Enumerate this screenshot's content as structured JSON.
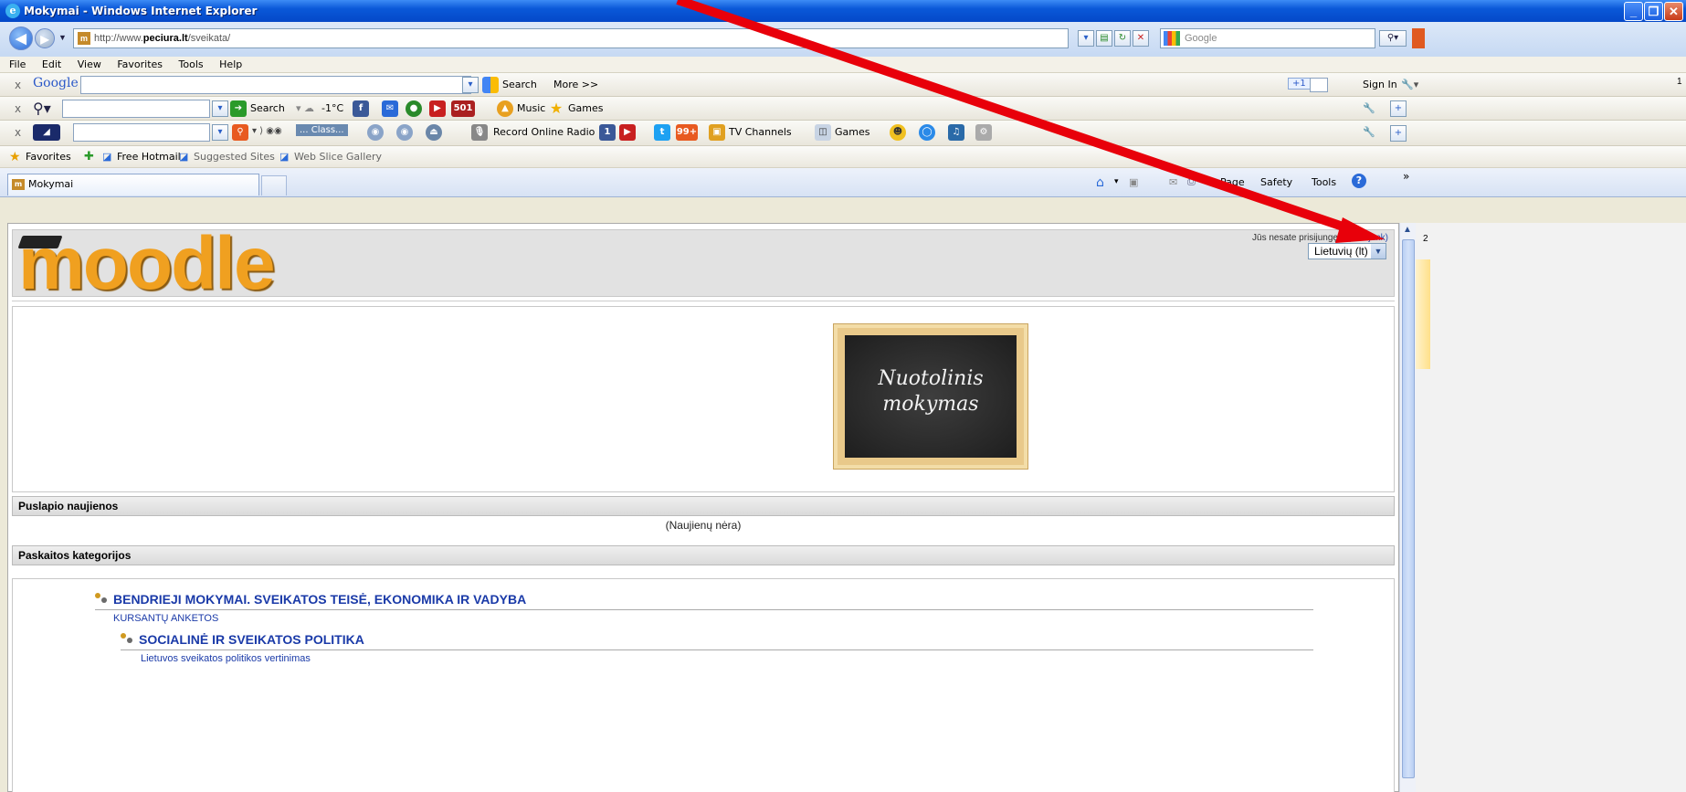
{
  "window": {
    "title": "Mokymai - Windows Internet Explorer"
  },
  "address": {
    "url_prefix": "http://www.",
    "url_domain": "peciura.lt",
    "url_path": "/sveikata/",
    "search_engine": "Google"
  },
  "menu": [
    "File",
    "Edit",
    "View",
    "Favorites",
    "Tools",
    "Help"
  ],
  "google_toolbar": {
    "brand": "Google",
    "search_label": "Search",
    "more_label": "More >>",
    "plus_one": "+1",
    "sign_in": "Sign In"
  },
  "toolbar2": {
    "search_label": "Search",
    "temp": "-1°C",
    "badge": "501",
    "music": "Music",
    "games": "Games"
  },
  "toolbar3": {
    "class_label": "... Class...",
    "radio_label": "Record Online Radio",
    "tv_label": "TV Channels",
    "games": "Games",
    "badge_fb": "1",
    "badge_rss": "99+"
  },
  "favorites": {
    "label": "Favorites",
    "items": [
      "Free Hotmail",
      "Suggested Sites",
      "Web Slice Gallery"
    ]
  },
  "tab": {
    "label": "Mokymai"
  },
  "command_bar": {
    "page": "Page",
    "safety": "Safety",
    "tools": "Tools"
  },
  "page": {
    "logo": "moodle",
    "login_text": "Jūs nesate prisijungęs.",
    "login_link": "(Prisijunk)",
    "language": "Lietuvių (lt)",
    "banner_line1": "Nuotolinis",
    "banner_line2": "mokymas",
    "news_heading": "Puslapio naujienos",
    "news_empty": "(Naujienų nėra)",
    "categories_heading": "Paskaitos kategorijos",
    "categories": [
      {
        "title": "BENDRIEJI MOKYMAI. SVEIKATOS TEISĖ, EKONOMIKA IR VADYBA",
        "sub": "KURSANTŲ ANKETOS"
      },
      {
        "title": "SOCIALINĖ IR SVEIKATOS POLITIKA",
        "sub": "Lietuvos sveikatos politikos vertinimas"
      }
    ]
  },
  "side_numbers": [
    "1",
    "2"
  ],
  "colors": {
    "arrow": "#e8000a",
    "title_bar": "#0a58d8",
    "logo": "#f0a020",
    "link": "#1a3aa8"
  }
}
